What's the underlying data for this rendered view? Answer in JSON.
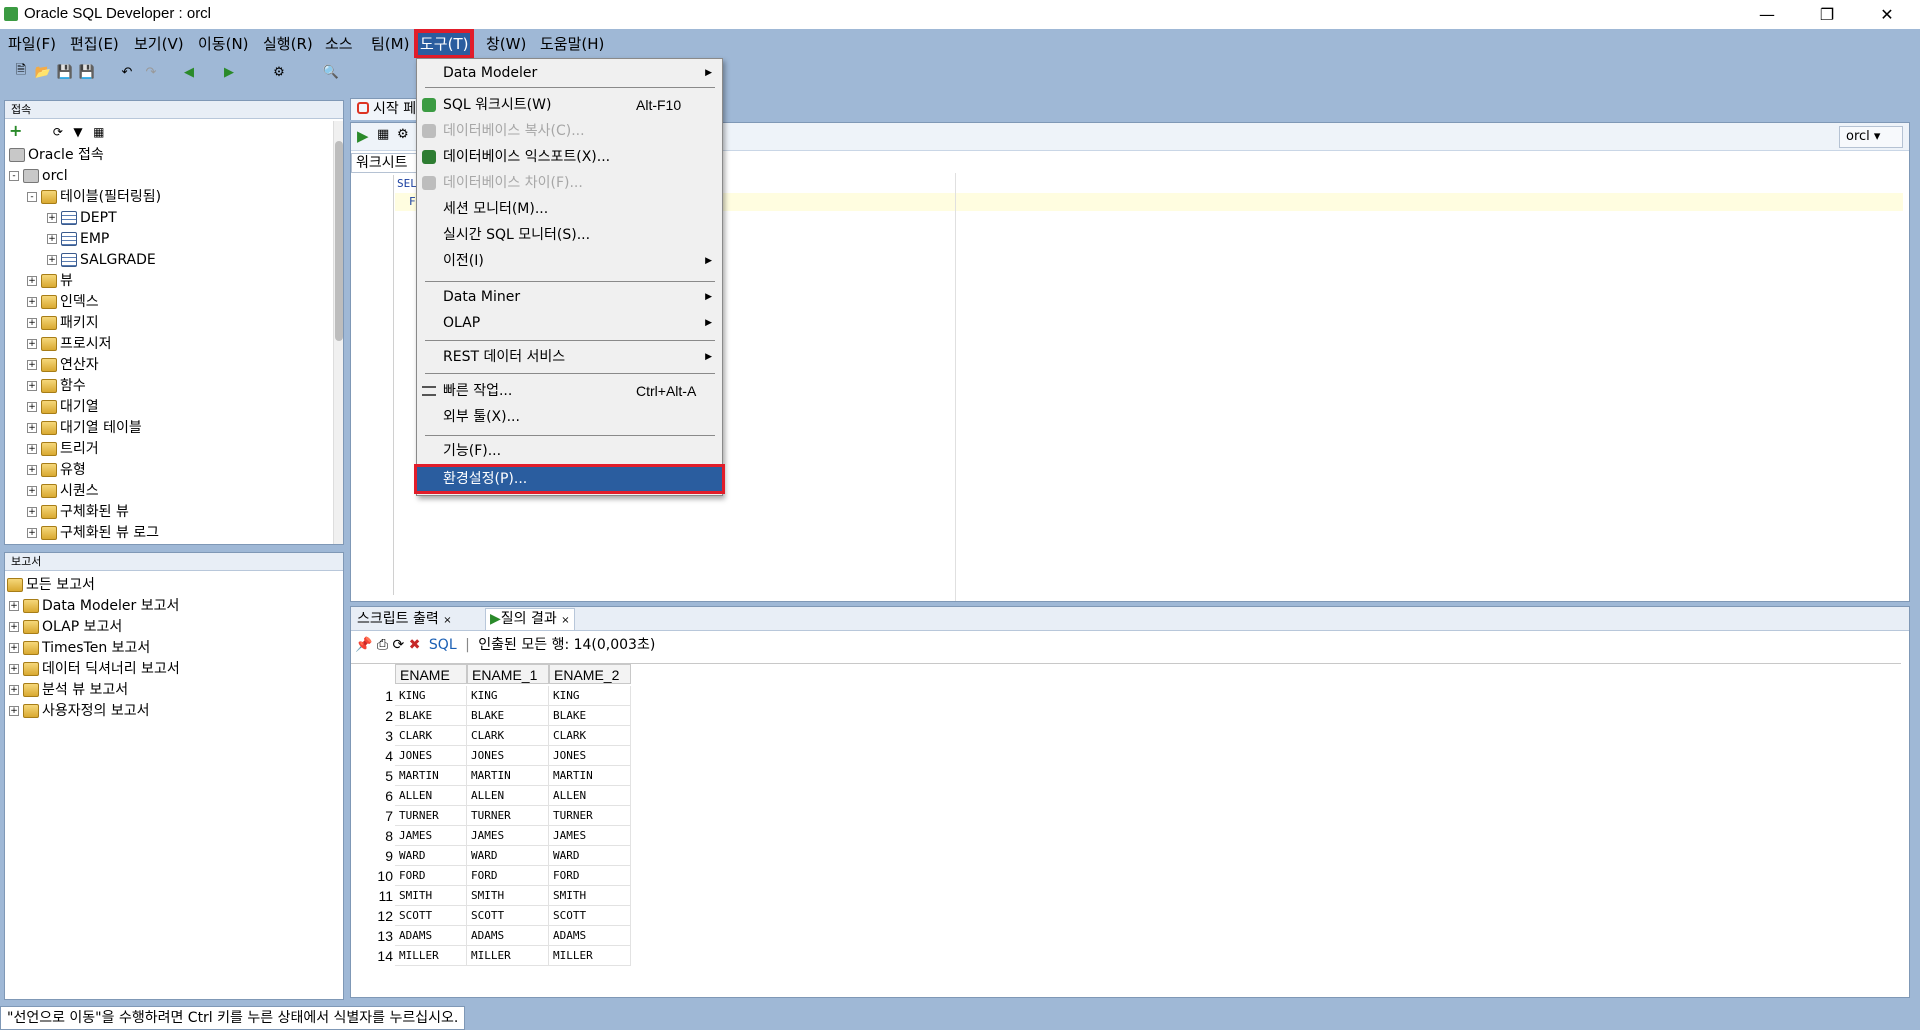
{
  "window": {
    "title": "Oracle SQL Developer : orcl"
  },
  "menubar": [
    {
      "label": "파일(F)"
    },
    {
      "label": "편집(E)"
    },
    {
      "label": "보기(V)"
    },
    {
      "label": "이동(N)"
    },
    {
      "label": "실행(R)"
    },
    {
      "label": "소스"
    },
    {
      "label": "팀(M)"
    },
    {
      "label": "도구(T)"
    },
    {
      "label": "창(W)"
    },
    {
      "label": "도움말(H)"
    }
  ],
  "connections": {
    "header": "접속",
    "root": "Oracle 접속",
    "conn": "orcl",
    "items": [
      {
        "label": "테이블(필터링됨)"
      },
      {
        "label": "DEPT"
      },
      {
        "label": "EMP"
      },
      {
        "label": "SALGRADE"
      },
      {
        "label": "뷰"
      },
      {
        "label": "인덱스"
      },
      {
        "label": "패키지"
      },
      {
        "label": "프로시저"
      },
      {
        "label": "연산자"
      },
      {
        "label": "함수"
      },
      {
        "label": "대기열"
      },
      {
        "label": "대기열 테이블"
      },
      {
        "label": "트리거"
      },
      {
        "label": "유형"
      },
      {
        "label": "시퀀스"
      },
      {
        "label": "구체화된 뷰"
      },
      {
        "label": "구체화된 뷰 로그"
      }
    ]
  },
  "reports": {
    "header": "보고서",
    "items": [
      {
        "label": "모든 보고서"
      },
      {
        "label": "Data Modeler 보고서"
      },
      {
        "label": "OLAP 보고서"
      },
      {
        "label": "TimesTen 보고서"
      },
      {
        "label": "데이터 딕셔너리 보고서"
      },
      {
        "label": "분석 뷰 보고서"
      },
      {
        "label": "사용자정의 보고서"
      }
    ]
  },
  "editor": {
    "tab_label": "시작 페",
    "worksheet_tab": "워크시트",
    "code_fragment_1": "SEL",
    "code_fragment_2": "F",
    "connection_select": "orcl"
  },
  "tools_menu": {
    "items": [
      {
        "label": "Data Modeler",
        "submenu": true
      },
      {
        "label": "SQL 워크시트(W)",
        "accel": "Alt-F10",
        "icon": "sql-worksheet-icon"
      },
      {
        "label": "데이터베이스 복사(C)...",
        "disabled": true,
        "icon": "db-copy-icon"
      },
      {
        "label": "데이터베이스 익스포트(X)...",
        "icon": "db-export-icon"
      },
      {
        "label": "데이터베이스 차이(F)...",
        "disabled": true,
        "icon": "db-diff-icon"
      },
      {
        "label": "세션 모니터(M)..."
      },
      {
        "label": "실시간 SQL 모니터(S)..."
      },
      {
        "label": "이전(I)",
        "submenu": true
      },
      {
        "label": "Data Miner",
        "submenu": true
      },
      {
        "label": "OLAP",
        "submenu": true
      },
      {
        "label": "REST 데이터 서비스",
        "submenu": true
      },
      {
        "label": "빠른 작업...",
        "accel": "Ctrl+Alt-A",
        "icon": "quick-action-icon"
      },
      {
        "label": "외부 툴(X)..."
      },
      {
        "label": "기능(F)..."
      },
      {
        "label": "환경설정(P)..."
      }
    ]
  },
  "results": {
    "tab_script": "스크립트 출력",
    "tab_query": "질의 결과",
    "sql_link": "SQL",
    "fetch_info": "인출된 모든 행: 14(0,003초)",
    "columns": [
      "ENAME",
      "ENAME_1",
      "ENAME_2"
    ],
    "rows": [
      [
        "1",
        "KING",
        "KING",
        "KING"
      ],
      [
        "2",
        "BLAKE",
        "BLAKE",
        "BLAKE"
      ],
      [
        "3",
        "CLARK",
        "CLARK",
        "CLARK"
      ],
      [
        "4",
        "JONES",
        "JONES",
        "JONES"
      ],
      [
        "5",
        "MARTIN",
        "MARTIN",
        "MARTIN"
      ],
      [
        "6",
        "ALLEN",
        "ALLEN",
        "ALLEN"
      ],
      [
        "7",
        "TURNER",
        "TURNER",
        "TURNER"
      ],
      [
        "8",
        "JAMES",
        "JAMES",
        "JAMES"
      ],
      [
        "9",
        "WARD",
        "WARD",
        "WARD"
      ],
      [
        "10",
        "FORD",
        "FORD",
        "FORD"
      ],
      [
        "11",
        "SMITH",
        "SMITH",
        "SMITH"
      ],
      [
        "12",
        "SCOTT",
        "SCOTT",
        "SCOTT"
      ],
      [
        "13",
        "ADAMS",
        "ADAMS",
        "ADAMS"
      ],
      [
        "14",
        "MILLER",
        "MILLER",
        "MILLER"
      ]
    ]
  },
  "status": {
    "message": "\"선언으로 이동\"을 수행하려면 Ctrl 키를 누른 상태에서 식별자를 누르십시오."
  },
  "colors": {
    "chrome": "#9fb8d6",
    "highlight": "#2a5d9f",
    "annotation_red": "#e11d2a"
  }
}
